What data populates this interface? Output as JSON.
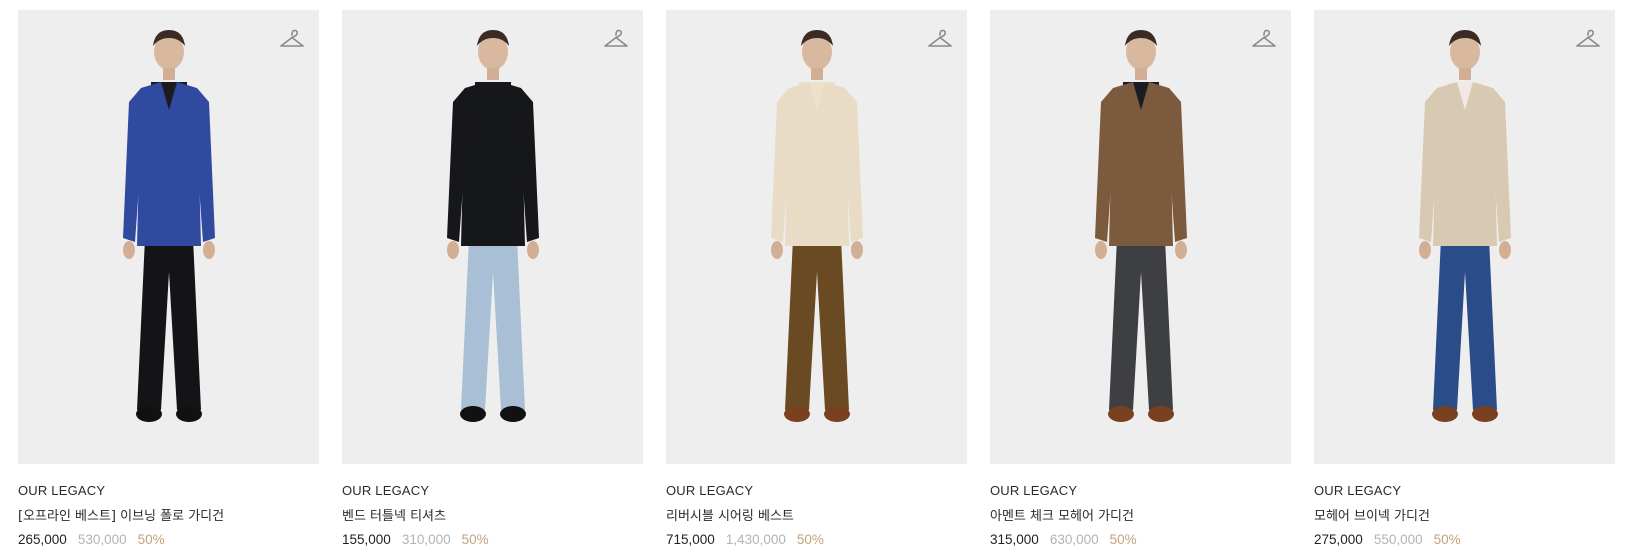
{
  "products": [
    {
      "brand": "OUR LEGACY",
      "name": "[오프라인 베스트] 이브닝 폴로 가디건",
      "sale_price": "265,000",
      "original_price": "530,000",
      "discount": "50%",
      "colors": {
        "top": "#2f4a9e",
        "inner": "#1a1a1f",
        "bottom": "#141418",
        "shoe": "#111111"
      }
    },
    {
      "brand": "OUR LEGACY",
      "name": "벤드 터틀넥 티셔츠",
      "sale_price": "155,000",
      "original_price": "310,000",
      "discount": "50%",
      "colors": {
        "top": "#16171b",
        "inner": "#16171b",
        "bottom": "#a9bfd6",
        "shoe": "#111111"
      }
    },
    {
      "brand": "OUR LEGACY",
      "name": "리버시블 시어링 베스트",
      "sale_price": "715,000",
      "original_price": "1,430,000",
      "discount": "50%",
      "colors": {
        "top": "#e9dcc6",
        "inner": "#efe0c8",
        "bottom": "#6a4a22",
        "shoe": "#7a4120"
      }
    },
    {
      "brand": "OUR LEGACY",
      "name": "아멘트 체크 모헤어 가디건",
      "sale_price": "315,000",
      "original_price": "630,000",
      "discount": "50%",
      "colors": {
        "top": "#7b5a3e",
        "inner": "#1c1d22",
        "bottom": "#3e3f42",
        "shoe": "#7a4120"
      }
    },
    {
      "brand": "OUR LEGACY",
      "name": "모헤어 브이넥 가디건",
      "sale_price": "275,000",
      "original_price": "550,000",
      "discount": "50%",
      "colors": {
        "top": "#d8c9b2",
        "inner": "#f2e9e6",
        "bottom": "#2a4d8a",
        "shoe": "#7a4120"
      }
    }
  ],
  "icons": {
    "wishlist": "hanger-icon",
    "photo": "model-photo"
  }
}
